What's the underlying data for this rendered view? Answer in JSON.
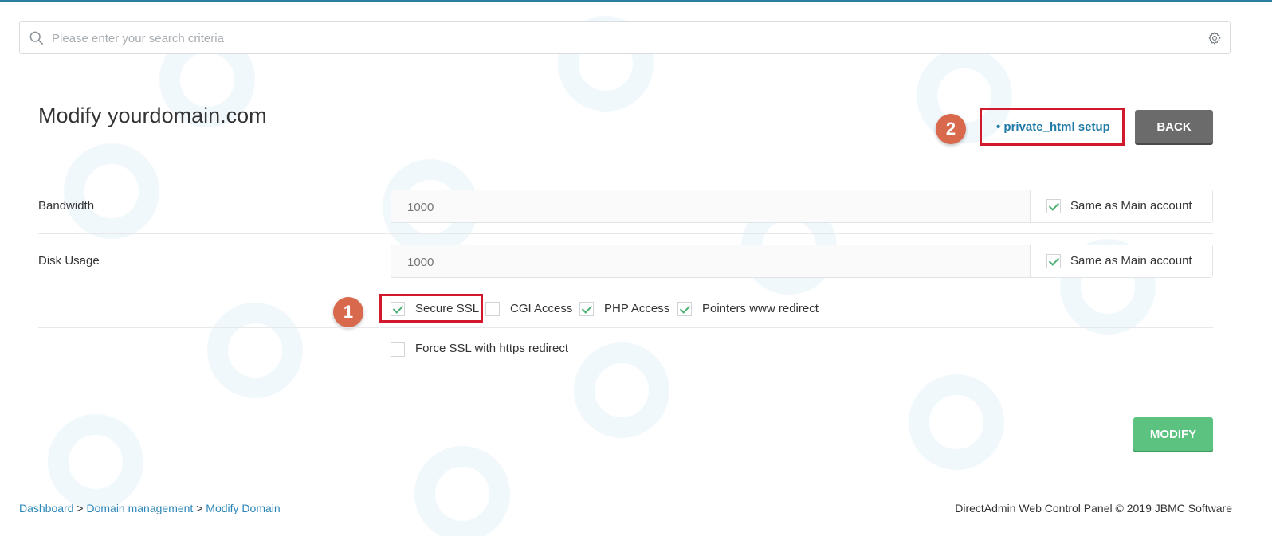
{
  "search": {
    "placeholder": "Please enter your search criteria"
  },
  "header": {
    "title": "Modify yourdomain.com",
    "private_link": "• private_html setup",
    "back_label": "BACK"
  },
  "annotations": {
    "badge_1": "1",
    "badge_2": "2"
  },
  "form": {
    "bandwidth": {
      "label": "Bandwidth",
      "value": "1000",
      "same_label": "Same as Main account",
      "same_checked": true
    },
    "disk_usage": {
      "label": "Disk Usage",
      "value": "1000",
      "same_label": "Same as Main account",
      "same_checked": true
    },
    "options": [
      {
        "label": "Secure SSL",
        "checked": true
      },
      {
        "label": "CGI Access",
        "checked": false
      },
      {
        "label": "PHP Access",
        "checked": true
      },
      {
        "label": "Pointers www redirect",
        "checked": true
      }
    ],
    "force_ssl": {
      "label": "Force SSL with https redirect",
      "checked": false
    },
    "modify_label": "MODIFY"
  },
  "breadcrumb": {
    "items": [
      "Dashboard",
      "Domain management",
      "Modify Domain"
    ],
    "separator": ">"
  },
  "footer": {
    "text": "DirectAdmin Web Control Panel © 2019 JBMC Software"
  },
  "colors": {
    "accent": "#1f7aa6",
    "modify": "#5cc27f",
    "back": "#6b6b6b",
    "highlight": "#d0192d",
    "badge": "#d9694c"
  }
}
